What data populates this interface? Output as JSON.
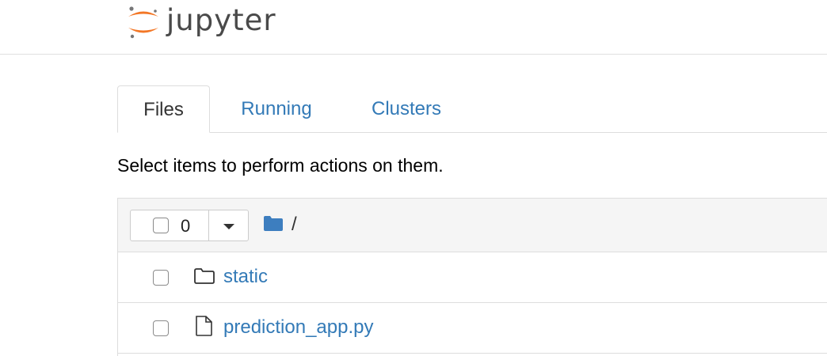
{
  "header": {
    "logo_text": "jupyter",
    "logo_icon": "jupyter-logo-icon",
    "colors": {
      "logo_orange": "#f37726",
      "logo_text": "#4a4a4a"
    }
  },
  "tabs": [
    {
      "label": "Files",
      "active": true
    },
    {
      "label": "Running",
      "active": false
    },
    {
      "label": "Clusters",
      "active": false
    }
  ],
  "instruction": "Select items to perform actions on them.",
  "toolbar": {
    "selected_count": "0",
    "dropdown_icon": "caret-down-icon",
    "breadcrumb_icon": "folder-icon",
    "breadcrumb_root": "/"
  },
  "files": [
    {
      "name": "static",
      "type": "folder",
      "icon": "folder-outline-icon"
    },
    {
      "name": "prediction_app.py",
      "type": "file",
      "icon": "file-icon"
    }
  ],
  "colors": {
    "link": "#337ab7",
    "border": "#dddddd",
    "header_bg": "#f5f5f5"
  }
}
